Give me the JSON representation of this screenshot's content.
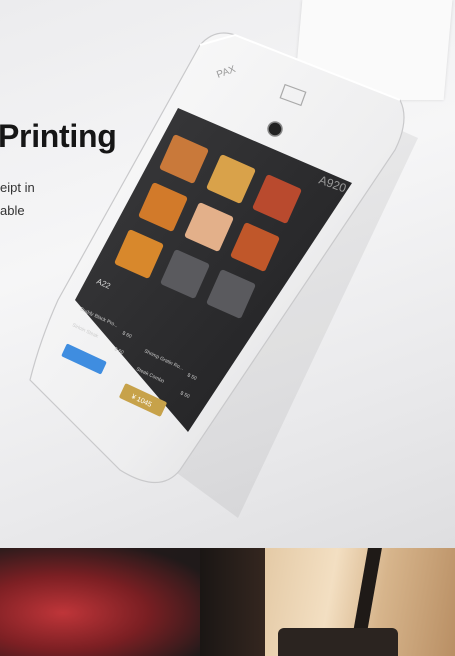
{
  "headline": "Printing",
  "description_lines": [
    "eipt in",
    "able"
  ],
  "device": {
    "brand": "PAX",
    "model": "A920",
    "screen": {
      "table": "A22",
      "items": [
        {
          "name": "Buddy Black Pro...",
          "qty": "x1",
          "price": "$ 60"
        },
        {
          "name": "Sirloin Steak",
          "qty": "x1",
          "price": "$ 60"
        },
        {
          "name": "Shrimp Gratin Ro...",
          "qty": "x1",
          "price": "$ 50"
        },
        {
          "name": "Steak Combo",
          "qty": "x2",
          "price": "$ 50"
        }
      ],
      "total": "¥ 1045"
    }
  },
  "colors": {
    "screen_blue": "#3f8de0",
    "pay_gold": "#c7a24a",
    "tablecloth_red": "#b3262b"
  }
}
